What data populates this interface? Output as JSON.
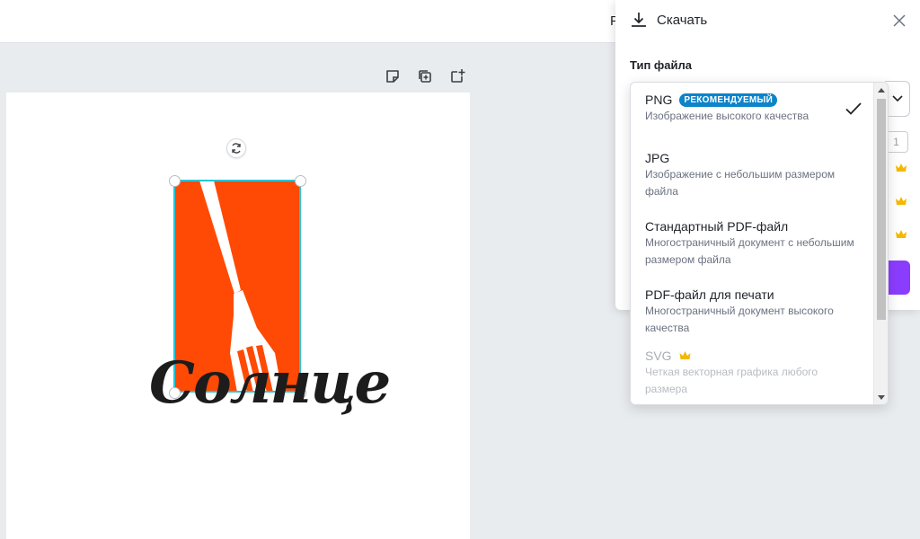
{
  "topbar": {
    "cut_text": "P"
  },
  "page_tools": {
    "note_icon": "sticky-note-icon",
    "duplicate_icon": "duplicate-page-icon",
    "add_icon": "add-page-icon"
  },
  "canvas": {
    "logo_text": "Солнце",
    "logo_color": "#ff4a05",
    "selection_color": "#2bc4d4"
  },
  "panel": {
    "title": "Скачать",
    "filetype_label": "Тип файла",
    "small_input_value": "1",
    "accent_color": "#8b3dff"
  },
  "dropdown": {
    "items": [
      {
        "name": "PNG",
        "badge": "РЕКОМЕНДУЕМЫЙ",
        "desc": "Изображение высокого качества",
        "selected": true
      },
      {
        "name": "JPG",
        "desc": "Изображение с небольшим размером файла"
      },
      {
        "name": "Стандартный PDF-файл",
        "desc": "Многостраничный документ с небольшим размером файла"
      },
      {
        "name": "PDF-файл для печати",
        "desc": "Многостраничный документ высокого качества"
      },
      {
        "name": "SVG",
        "desc": "Четкая векторная графика любого размера",
        "premium": true,
        "disabled": true
      }
    ]
  }
}
